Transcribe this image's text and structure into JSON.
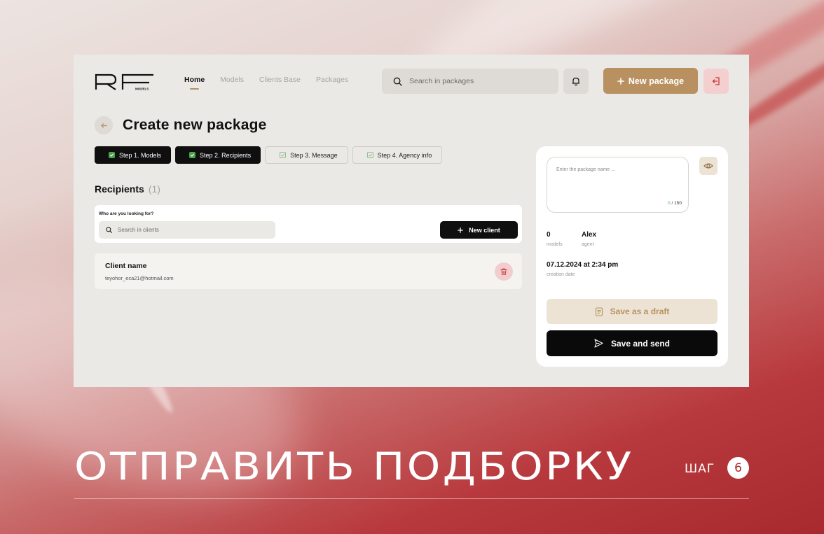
{
  "nav": {
    "logo_alt": "RF MODELS",
    "items": [
      {
        "label": "Home",
        "active": true
      },
      {
        "label": "Models",
        "active": false
      },
      {
        "label": "Clients Base",
        "active": false
      },
      {
        "label": "Packages",
        "active": false
      }
    ],
    "search_placeholder": "Search in packages",
    "new_package_label": "New package"
  },
  "page": {
    "title": "Create new package"
  },
  "steps": [
    {
      "label": "Step 1. Models",
      "done": true
    },
    {
      "label": "Step 2. Recipients",
      "done": true
    },
    {
      "label": "Step 3. Message",
      "done": false
    },
    {
      "label": "Step 4. Agency info",
      "done": false
    }
  ],
  "recipients": {
    "title": "Recipients",
    "count": "(1)",
    "search_label": "Who are you looking for?",
    "search_placeholder": "Search in clients",
    "new_client_label": "New client",
    "clients": [
      {
        "name": "Client name",
        "email": "teyohor_eca21@hotmail.com"
      }
    ]
  },
  "side_panel": {
    "name_placeholder": "Enter the package name ...",
    "counter_current": "0",
    "counter_max": "/ 150",
    "models_value": "0",
    "models_label": "models",
    "agent_value": "Alex",
    "agent_label": "agent",
    "date_value": "07.12.2024 at 2:34 pm",
    "date_label": "creation date",
    "draft_label": "Save as a draft",
    "send_label": "Save and send"
  },
  "caption": {
    "text": "ОТПРАВИТЬ ПОДБОРКУ",
    "step_label": "ШАГ",
    "step_number": "6"
  },
  "colors": {
    "accent_gold": "#b9905f",
    "accent_red": "#a82a2e",
    "success_green": "#4aa34a",
    "app_bg": "#ebe9e5"
  },
  "icons": [
    "search-icon",
    "bell-icon",
    "plus-icon",
    "logout-icon",
    "arrow-left-icon",
    "check-icon",
    "trash-icon",
    "eye-icon",
    "document-icon",
    "send-icon"
  ]
}
